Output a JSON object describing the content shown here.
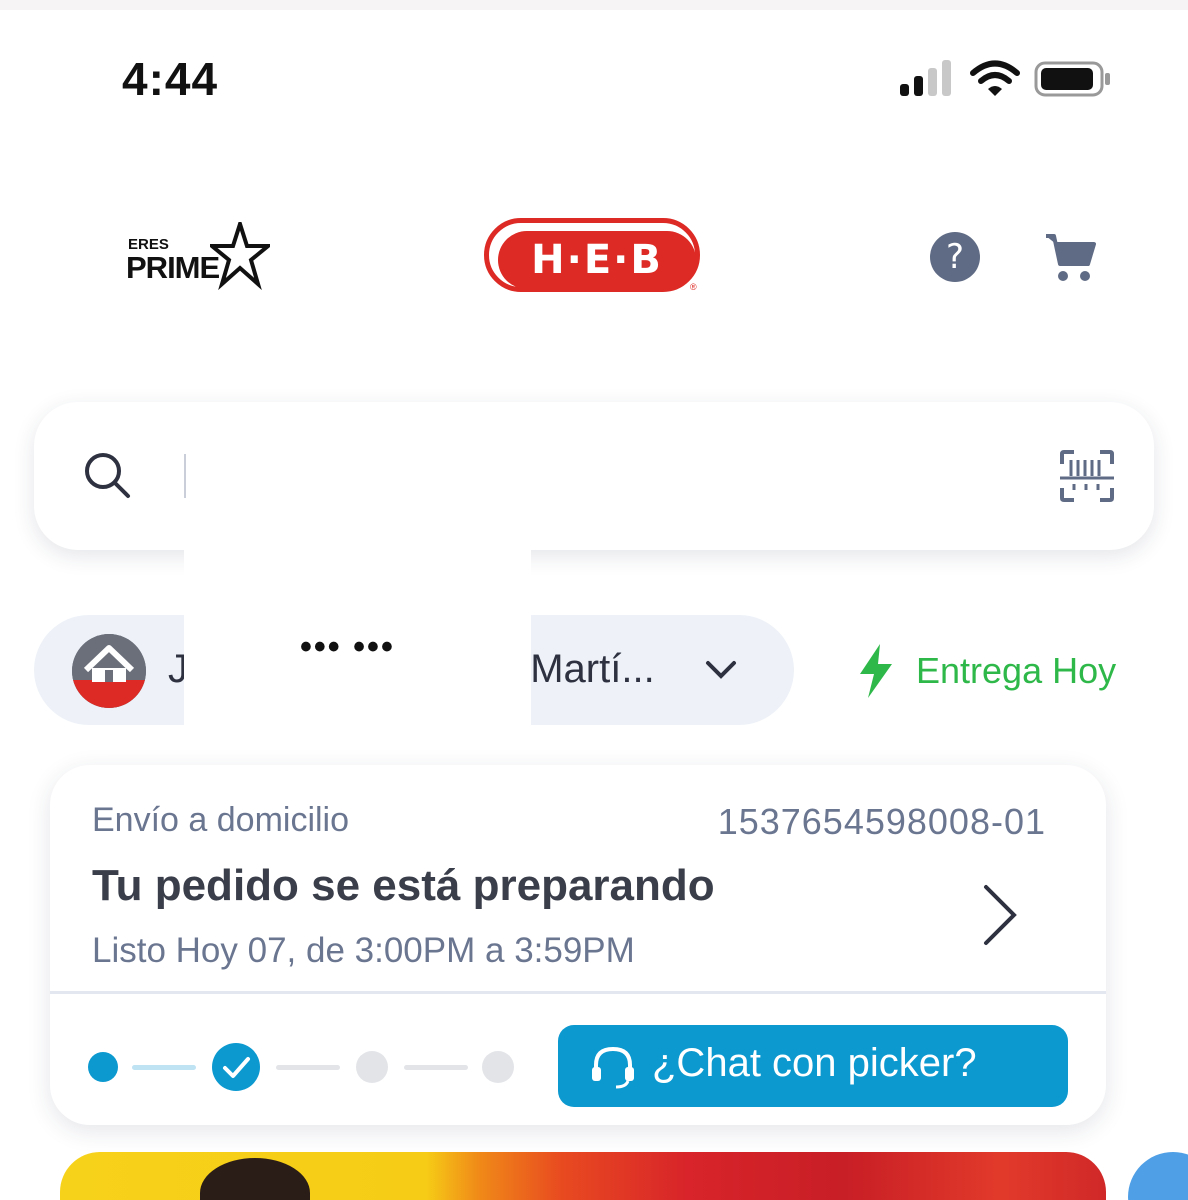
{
  "status_bar": {
    "time": "4:44"
  },
  "header": {
    "prime_logo": {
      "small": "ERES",
      "big": "PRIME"
    },
    "brand_logo": {
      "text": "H·E·B",
      "reg": "®"
    },
    "help_icon": "question-circle-icon",
    "cart_icon": "shopping-cart-icon"
  },
  "search": {
    "value": "",
    "placeholder": "",
    "icon": "search-icon",
    "scan_icon": "barcode-scan-icon"
  },
  "address": {
    "icon": "home-icon",
    "label": "J",
    "label_tail": ", Martí...",
    "masked": "••• •••"
  },
  "delivery": {
    "label": "Entrega Hoy",
    "icon": "lightning-icon",
    "color": "#2fb84a"
  },
  "order": {
    "type": "Envío a domicilio",
    "number": "1537654598008-01",
    "status": "Tu pedido se está preparando",
    "time": "Listo Hoy 07, de 3:00PM a 3:59PM",
    "progress": {
      "total_steps": 4,
      "completed_step": 2
    },
    "chat_button": "¿Chat con picker?"
  },
  "colors": {
    "brand_red": "#dd2a24",
    "accent_blue": "#0b99d0",
    "delivery_green": "#2fb84a"
  }
}
